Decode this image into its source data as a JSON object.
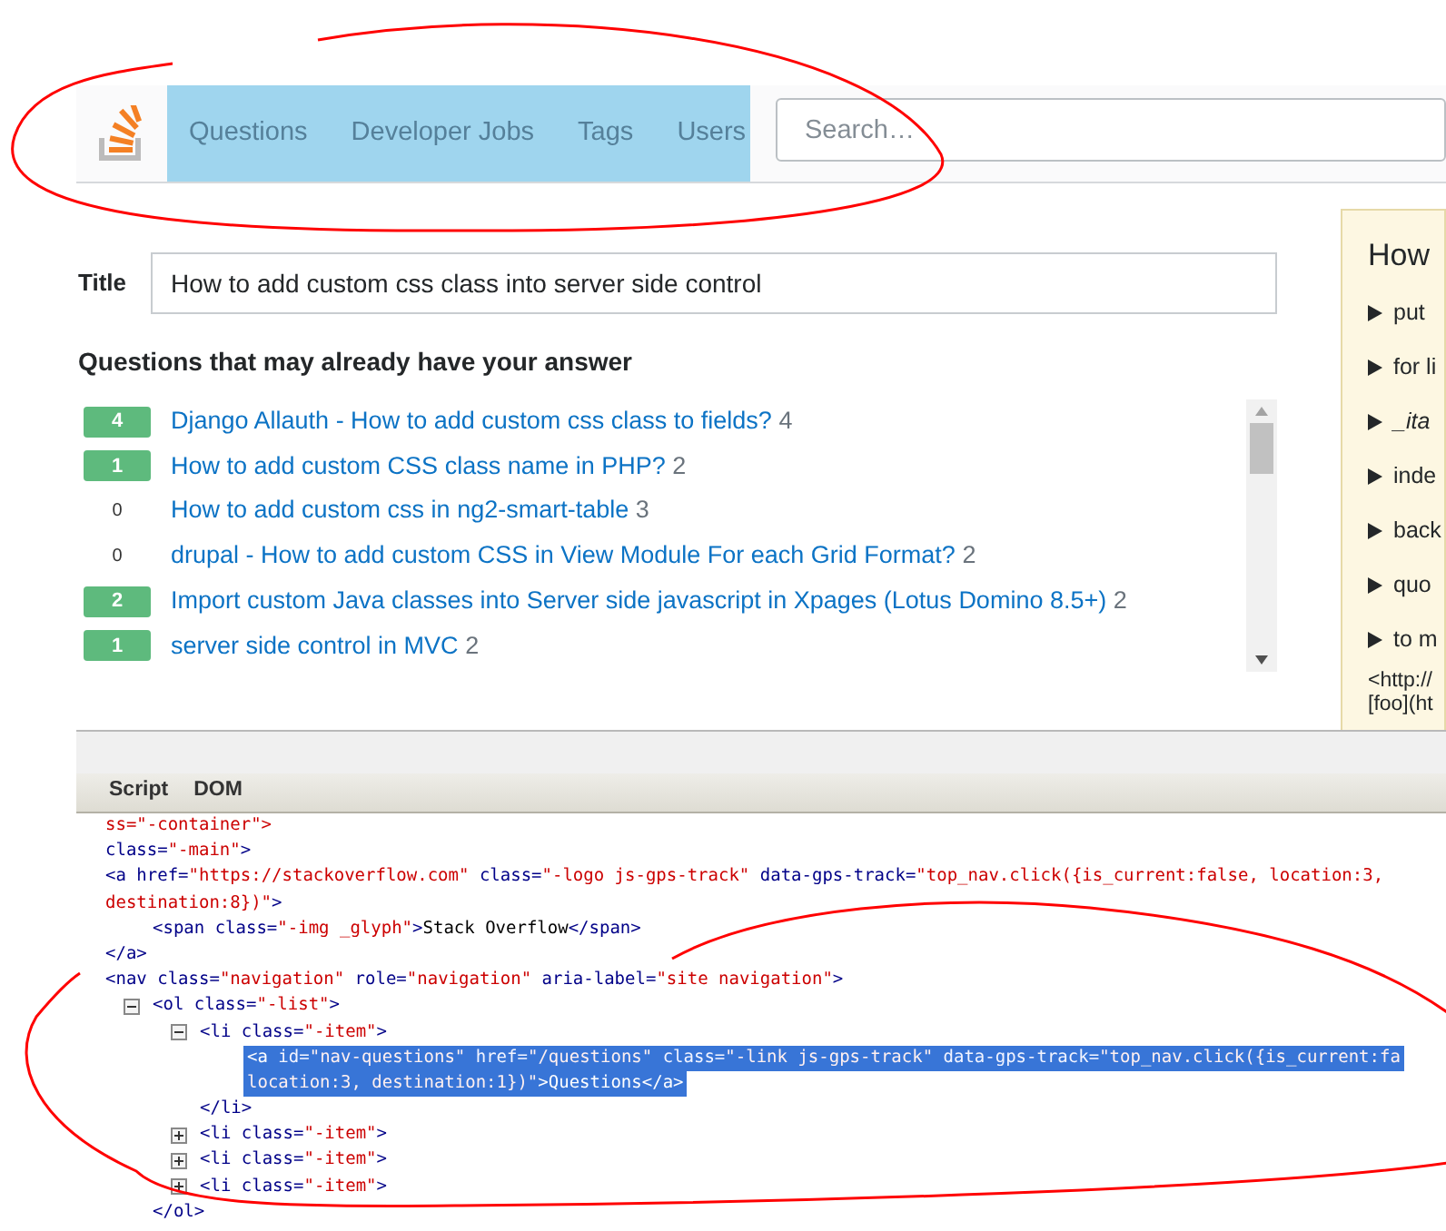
{
  "header": {
    "nav": [
      {
        "label": "Questions"
      },
      {
        "label": "Developer Jobs"
      },
      {
        "label": "Tags"
      },
      {
        "label": "Users"
      }
    ],
    "search": {
      "placeholder": "Search…"
    }
  },
  "title_field": {
    "label": "Title",
    "value": "How to add custom css class into server side control"
  },
  "similar": {
    "heading": "Questions that may already have your answer",
    "items": [
      {
        "votes": "4",
        "answered": true,
        "title": "Django Allauth - How to add custom css class to fields?",
        "count": "4"
      },
      {
        "votes": "1",
        "answered": true,
        "title": "How to add custom CSS class name in PHP?",
        "count": "2"
      },
      {
        "votes": "0",
        "answered": false,
        "title": "How to add custom css in ng2-smart-table",
        "count": "3"
      },
      {
        "votes": "0",
        "answered": false,
        "title": "drupal - How to add custom CSS in View Module For each Grid Format?",
        "count": "2"
      },
      {
        "votes": "2",
        "answered": true,
        "title": "Import custom Java classes into Server side javascript in Xpages (Lotus Domino 8.5+)",
        "count": "2"
      },
      {
        "votes": "1",
        "answered": true,
        "title": "server side control in MVC",
        "count": "2"
      }
    ]
  },
  "help_panel": {
    "heading": "How",
    "items": [
      {
        "text": "put",
        "italic": false
      },
      {
        "text": "for li",
        "italic": false
      },
      {
        "text": "_ita",
        "italic": true
      },
      {
        "text": "inde",
        "italic": false
      },
      {
        "text": "back",
        "italic": false
      },
      {
        "text": "quo",
        "italic": false
      },
      {
        "text": "to m",
        "italic": false
      }
    ],
    "footer": [
      "<http://",
      "[foo](ht"
    ]
  },
  "devtools": {
    "tabs": [
      {
        "label": "Script"
      },
      {
        "label": "DOM"
      }
    ],
    "tree": [
      {
        "lines": [
          [
            {
              "kind": "value",
              "text": "ss=\"-container\">"
            }
          ]
        ]
      },
      {
        "lines": [
          [
            {
              "kind": "attr",
              "text": "class="
            },
            {
              "kind": "value",
              "text": "\"-main\""
            },
            {
              "kind": "tag",
              "text": ">"
            }
          ]
        ]
      },
      {
        "lines": [
          [
            {
              "kind": "tag",
              "text": "<a "
            },
            {
              "kind": "attr",
              "text": "href="
            },
            {
              "kind": "value",
              "text": "\"https://stackoverflow.com\""
            },
            {
              "kind": "attr",
              "text": " class="
            },
            {
              "kind": "value",
              "text": "\"-logo js-gps-track\""
            },
            {
              "kind": "attr",
              "text": " data-gps-track="
            },
            {
              "kind": "value",
              "text": "\"top_nav.click({is_current:false, location:3,"
            }
          ],
          [
            {
              "kind": "value",
              "text": "destination:8})\""
            },
            {
              "kind": "tag",
              "text": ">"
            }
          ]
        ],
        "children": [
          {
            "lines": [
              [
                {
                  "kind": "tag",
                  "text": "<span "
                },
                {
                  "kind": "attr",
                  "text": "class="
                },
                {
                  "kind": "value",
                  "text": "\"-img _glyph\""
                },
                {
                  "kind": "tag",
                  "text": ">"
                },
                {
                  "kind": "text",
                  "text": "Stack Overflow"
                },
                {
                  "kind": "tag",
                  "text": "</span>"
                }
              ]
            ]
          }
        ],
        "close": "</a>"
      },
      {
        "lines": [
          [
            {
              "kind": "tag",
              "text": "<nav "
            },
            {
              "kind": "attr",
              "text": "class="
            },
            {
              "kind": "value",
              "text": "\"navigation\""
            },
            {
              "kind": "attr",
              "text": " role="
            },
            {
              "kind": "value",
              "text": "\"navigation\""
            },
            {
              "kind": "attr",
              "text": " aria-label="
            },
            {
              "kind": "value",
              "text": "\"site navigation\""
            },
            {
              "kind": "tag",
              "text": ">"
            }
          ]
        ],
        "children": [
          {
            "expanded": true,
            "lines": [
              [
                {
                  "kind": "tag",
                  "text": "<ol "
                },
                {
                  "kind": "attr",
                  "text": "class="
                },
                {
                  "kind": "value",
                  "text": "\"-list\""
                },
                {
                  "kind": "tag",
                  "text": ">"
                }
              ]
            ],
            "children": [
              {
                "expanded": true,
                "lines": [
                  [
                    {
                      "kind": "tag",
                      "text": "<li "
                    },
                    {
                      "kind": "attr",
                      "text": "class="
                    },
                    {
                      "kind": "value",
                      "text": "\"-item\""
                    },
                    {
                      "kind": "tag",
                      "text": ">"
                    }
                  ]
                ],
                "children": [
                  {
                    "selected": true,
                    "lines": [
                      [
                        {
                          "kind": "tag",
                          "text": "<a "
                        },
                        {
                          "kind": "attr",
                          "text": "id="
                        },
                        {
                          "kind": "value",
                          "text": "\"nav-questions\""
                        },
                        {
                          "kind": "attr",
                          "text": " href="
                        },
                        {
                          "kind": "value",
                          "text": "\"/questions\""
                        },
                        {
                          "kind": "attr",
                          "text": " class="
                        },
                        {
                          "kind": "value",
                          "text": "\"-link js-gps-track\""
                        },
                        {
                          "kind": "attr",
                          "text": " data-gps-track="
                        },
                        {
                          "kind": "value",
                          "text": "\"top_nav.click({is_current:fa"
                        }
                      ],
                      [
                        {
                          "kind": "value",
                          "text": "location:3, destination:1})\""
                        },
                        {
                          "kind": "tag",
                          "text": ">"
                        },
                        {
                          "kind": "text",
                          "text": "Questions"
                        },
                        {
                          "kind": "tag",
                          "text": "</a>"
                        }
                      ]
                    ]
                  }
                ],
                "close": "</li>"
              },
              {
                "expanded": false,
                "lines": [
                  [
                    {
                      "kind": "tag",
                      "text": "<li "
                    },
                    {
                      "kind": "attr",
                      "text": "class="
                    },
                    {
                      "kind": "value",
                      "text": "\"-item\""
                    },
                    {
                      "kind": "tag",
                      "text": ">"
                    }
                  ]
                ]
              },
              {
                "expanded": false,
                "lines": [
                  [
                    {
                      "kind": "tag",
                      "text": "<li "
                    },
                    {
                      "kind": "attr",
                      "text": "class="
                    },
                    {
                      "kind": "value",
                      "text": "\"-item\""
                    },
                    {
                      "kind": "tag",
                      "text": ">"
                    }
                  ]
                ]
              },
              {
                "expanded": false,
                "lines": [
                  [
                    {
                      "kind": "tag",
                      "text": "<li "
                    },
                    {
                      "kind": "attr",
                      "text": "class="
                    },
                    {
                      "kind": "value",
                      "text": "\"-item\""
                    },
                    {
                      "kind": "tag",
                      "text": ">"
                    }
                  ]
                ]
              }
            ],
            "close": "</ol>"
          }
        ]
      }
    ]
  }
}
